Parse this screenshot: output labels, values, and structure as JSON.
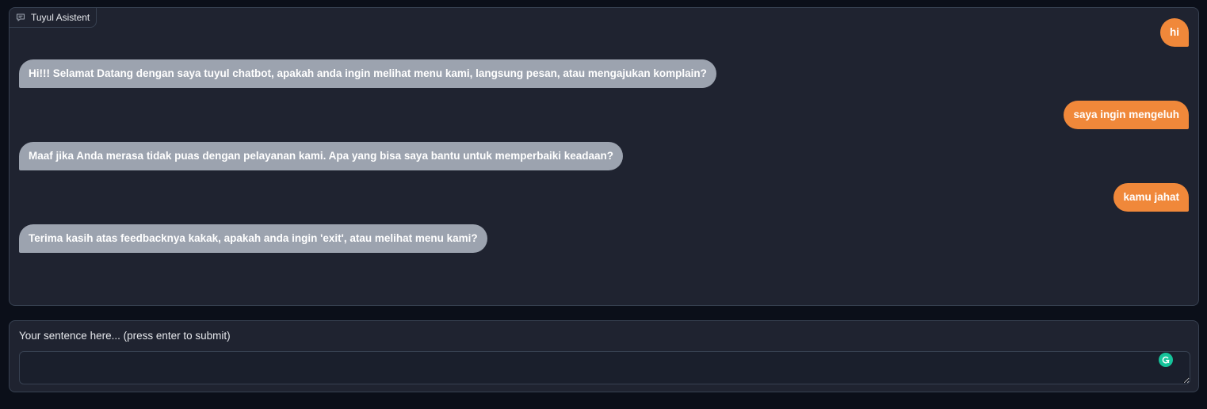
{
  "chatbot": {
    "label": "Tuyul Asistent",
    "messages": [
      {
        "role": "user",
        "text": "hi"
      },
      {
        "role": "bot",
        "text": "Hi!!! Selamat Datang dengan saya tuyul chatbot, apakah anda ingin melihat menu kami, langsung pesan, atau mengajukan komplain?"
      },
      {
        "role": "user",
        "text": "saya ingin mengeluh"
      },
      {
        "role": "bot",
        "text": "Maaf jika Anda merasa tidak puas dengan pelayanan kami. Apa yang bisa saya bantu untuk memperbaiki keadaan?"
      },
      {
        "role": "user",
        "text": "kamu jahat"
      },
      {
        "role": "bot",
        "text": "Terima kasih atas feedbacknya kakak, apakah anda ingin 'exit', atau melihat menu kami?"
      }
    ]
  },
  "input": {
    "label": "Your sentence here... (press enter to submit)",
    "value": "",
    "placeholder": ""
  },
  "icons": {
    "chat_label_icon": "chat-bubble-icon",
    "grammarly_icon": "grammarly-icon"
  },
  "colors": {
    "user_bubble": "#f0883a",
    "bot_bubble": "#9ca3af",
    "panel_bg": "#1f2330",
    "page_bg": "#0b0f19",
    "grammarly": "#15c39a"
  }
}
